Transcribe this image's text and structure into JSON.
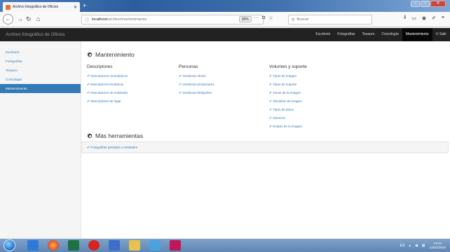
{
  "browser": {
    "tab_title": "Archivo fotográfico de Oficios",
    "tab_close": "✕",
    "new_tab": "+",
    "url_host": "localhost",
    "url_path": "/archivo/mantenimiento",
    "zoom": "80%",
    "search_placeholder": "Buscar"
  },
  "app": {
    "brand": "Archivo fotográfico de Oficios",
    "nav": [
      {
        "label": "Escritorio"
      },
      {
        "label": "Fotografías"
      },
      {
        "label": "Tesauro"
      },
      {
        "label": "Cronología"
      },
      {
        "label": "Mantenimiento"
      },
      {
        "label": "Salir"
      }
    ]
  },
  "sidebar": {
    "items": [
      {
        "label": "Escritorio"
      },
      {
        "label": "Fotografías"
      },
      {
        "label": "Tesauro"
      },
      {
        "label": "Cronología"
      },
      {
        "label": "Mantenimiento"
      }
    ]
  },
  "main": {
    "section1_title": "Mantenimiento",
    "columns": [
      {
        "heading": "Descriptores",
        "links": [
          "Descriptores onomásticos",
          "Descriptores temáticos",
          "Descriptores de entidades",
          "Descriptores de lugar"
        ]
      },
      {
        "heading": "Personas",
        "links": [
          "Gestionar ofcios",
          "Gestionar productores",
          "Gestionar fotógrafos"
        ]
      },
      {
        "heading": "Volumen y soporte",
        "links": [
          "Tipos de imagen",
          "Tipos de soporte",
          "Tonos de la imagen",
          "Tamaños de imagen",
          "Tipos de plano",
          "Géneros",
          "Estado de la imagen"
        ]
      }
    ],
    "section2_title": "Más herramientas",
    "tools": [
      "Fotografías pasadas a entidades"
    ]
  },
  "taskbar": {
    "lang": "ES",
    "time": "13:44",
    "date": "13/02/2020"
  },
  "colors": {
    "link": "#337ab7",
    "active_sidebar": "#337ab7",
    "appbar": "#222222"
  }
}
